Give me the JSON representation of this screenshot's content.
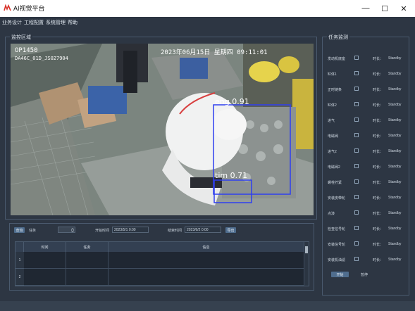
{
  "window": {
    "title": "AI视觉平台",
    "controls": {
      "minimize": "—",
      "maximize": "☐",
      "close": "✕"
    }
  },
  "menu": [
    "业务设计",
    "工程配置",
    "系统管理",
    "帮助"
  ],
  "monitor": {
    "title": "监控区域",
    "overlay": {
      "station": "OP1450",
      "code": "DA46C_01D_JS027904",
      "timestamp": "2023年06月15日 星期四 09:11:01"
    },
    "detections": [
      {
        "label": "eng",
        "score": "0.91"
      },
      {
        "label": "tim",
        "score": "0.71"
      }
    ]
  },
  "query": {
    "query_button": "查询",
    "task_label": "任务",
    "start_label": "开始时间",
    "start_value": "2023/5/1 0:00",
    "end_label": "结束时间",
    "end_value": "2023/6/2 0:00",
    "export_button": "导出"
  },
  "table": {
    "columns": [
      "",
      "时间",
      "任务",
      "信息"
    ],
    "rows": [
      "1",
      "2"
    ]
  },
  "task_monitor": {
    "title": "任务监测",
    "time_label": "时长：",
    "items": [
      {
        "name": "发动机底座",
        "status": "Standby"
      },
      {
        "name": "缸体1",
        "status": "Standby"
      },
      {
        "name": "正时链条",
        "status": "Standby"
      },
      {
        "name": "缸体2",
        "status": "Standby"
      },
      {
        "name": "进气",
        "status": "Standby"
      },
      {
        "name": "电磁阀",
        "status": "Standby"
      },
      {
        "name": "进气2",
        "status": "Standby"
      },
      {
        "name": "电磁阀2",
        "status": "Standby"
      },
      {
        "name": "螺栓拧紧",
        "status": "Standby"
      },
      {
        "name": "安装皮带轮",
        "status": "Standby"
      },
      {
        "name": "点漆",
        "status": "Standby"
      },
      {
        "name": "检查信号轮",
        "status": "Standby"
      },
      {
        "name": "安装信号轮",
        "status": "Standby"
      },
      {
        "name": "安装机油滤",
        "status": "Standby"
      }
    ],
    "start_button": "开始",
    "stop_button": "暂停"
  },
  "colors": {
    "background": "#2d3643",
    "detection_box": "#2f3ff0",
    "button": "#4f6d8e"
  }
}
